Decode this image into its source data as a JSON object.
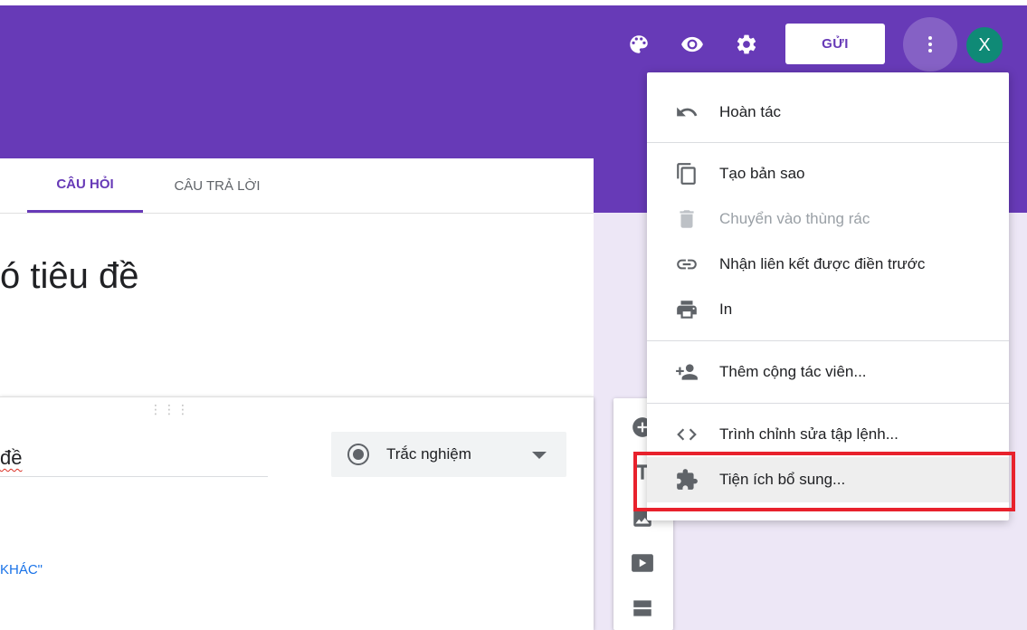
{
  "header": {
    "icons": [
      {
        "name": "palette-icon",
        "label": ""
      },
      {
        "name": "eye-icon",
        "label": ""
      },
      {
        "name": "gear-icon",
        "label": ""
      }
    ],
    "send_label": "GỬI",
    "avatar_letter": "X"
  },
  "tabs": [
    {
      "label": "CÂU HỎI",
      "active": true
    },
    {
      "label": "CÂU TRẢ LỜI",
      "active": false
    }
  ],
  "form": {
    "title_visible": "ó tiêu đề"
  },
  "question": {
    "title_visible": "đề",
    "type": "Trắc nghiệm",
    "add_other_visible": "KHÁC\""
  },
  "menu": {
    "items": [
      {
        "icon": "undo-icon",
        "label": "Hoàn tác",
        "disabled": false
      },
      {
        "icon": "copy-icon",
        "label": "Tạo bản sao",
        "disabled": false
      },
      {
        "icon": "trash-icon",
        "label": "Chuyển vào thùng rác",
        "disabled": true
      },
      {
        "icon": "link-icon",
        "label": "Nhận liên kết được điền trước",
        "disabled": false
      },
      {
        "icon": "print-icon",
        "label": "In",
        "disabled": false
      },
      {
        "icon": "add-people-icon",
        "label": "Thêm cộng tác viên...",
        "disabled": false
      },
      {
        "icon": "code-icon",
        "label": "Trình chỉnh sửa tập lệnh...",
        "disabled": false
      },
      {
        "icon": "puzzle-icon",
        "label": "Tiện ích bổ sung...",
        "disabled": false,
        "highlighted": true
      }
    ]
  },
  "colors": {
    "brand": "#673ab7",
    "background": "#ede7f6",
    "highlight_box": "#e8212c",
    "avatar": "#0f8a76"
  }
}
